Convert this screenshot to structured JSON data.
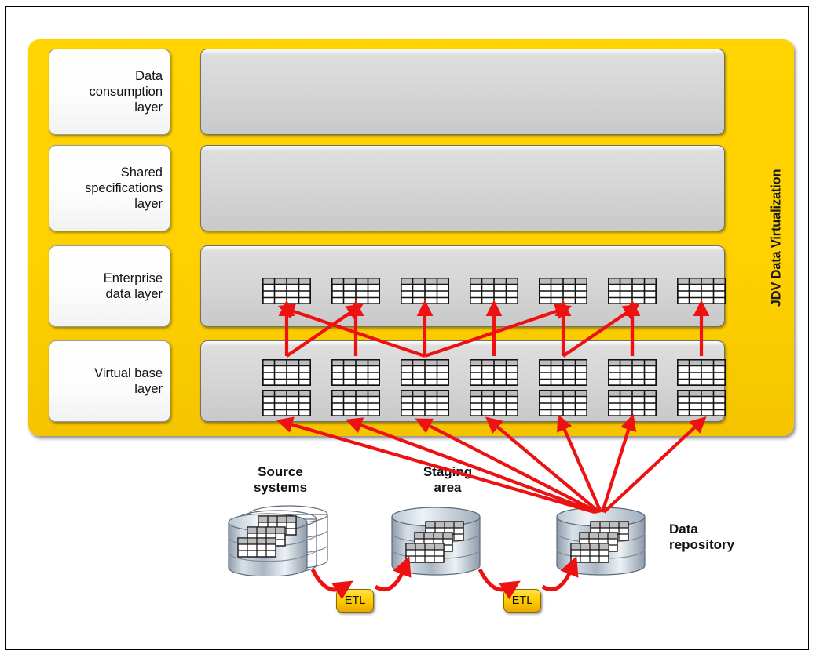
{
  "diagram": {
    "title": "JDV Data Virtualization reference architecture",
    "container": {
      "vertical_label": "JDV Data Virtualization",
      "color": "#ffd400"
    },
    "layers": [
      {
        "label": "Data\nconsumption\nlayer",
        "name": "data-consumption-layer",
        "tables_rows": 0,
        "tables_cols": 0
      },
      {
        "label": "Shared\nspecifications\nlayer",
        "name": "shared-specifications-layer",
        "tables_rows": 0,
        "tables_cols": 0
      },
      {
        "label": "Enterprise\ndata layer",
        "name": "enterprise-data-layer",
        "tables_rows": 1,
        "tables_cols": 7
      },
      {
        "label": "Virtual base\nlayer",
        "name": "virtual-base-layer",
        "tables_rows": 2,
        "tables_cols": 7
      }
    ],
    "sources": [
      {
        "label": "Source\nsystems",
        "name": "source-systems",
        "kind": "stacked-cylinder",
        "label_pos": "above"
      },
      {
        "label": "Staging\narea",
        "name": "staging-area",
        "kind": "cylinder",
        "label_pos": "above"
      },
      {
        "label": "Data\nrepository",
        "name": "data-repository",
        "kind": "cylinder",
        "label_pos": "right"
      }
    ],
    "etl_nodes": [
      {
        "label": "ETL",
        "name": "etl-source-to-staging"
      },
      {
        "label": "ETL",
        "name": "etl-staging-to-repository"
      }
    ],
    "flows": {
      "arrow_color": "#ee1111",
      "repository_to_virtual_base_count": 7,
      "virtual_base_to_enterprise_count": 12
    }
  }
}
